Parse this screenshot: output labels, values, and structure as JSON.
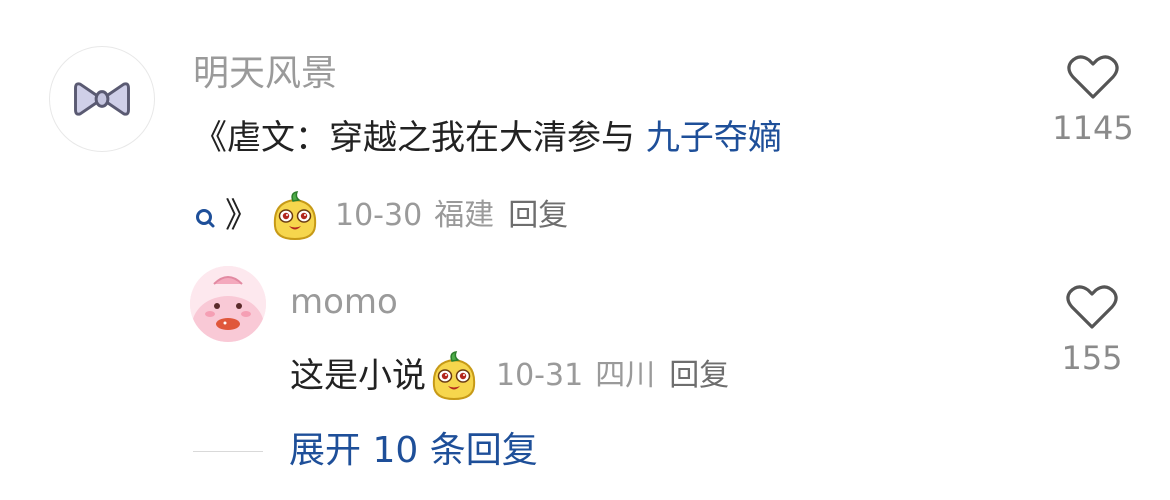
{
  "comments": [
    {
      "username": "明天风景",
      "text_prefix": "《虐文：穿越之我在大清参与 ",
      "link_text": "九子夺嫡",
      "text_suffix": "》",
      "date": "10-30",
      "location": "福建",
      "reply_label": "回复",
      "like_count": "1145",
      "avatar_icon": "bow-icon",
      "emoji_icon": "cute-sticker-emoji-icon"
    },
    {
      "username": "momo",
      "text": "这是小说",
      "date": "10-31",
      "location": "四川",
      "reply_label": "回复",
      "like_count": "155",
      "avatar_icon": "pink-character-avatar",
      "emoji_icon": "cute-sticker-emoji-icon"
    }
  ],
  "expand": {
    "label": "展开 10 条回复"
  },
  "colors": {
    "link": "#1e4f99",
    "meta": "#9a9a9a",
    "text": "#222222"
  }
}
